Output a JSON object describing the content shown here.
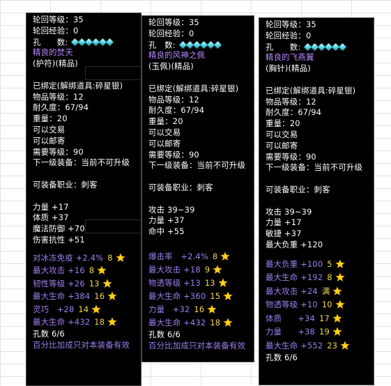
{
  "panels": [
    {
      "reincarnation_level": "轮回等级：35",
      "reincarnation_exp": "轮回经验：0",
      "holes_label": "孔　　数:",
      "name": "精良的焚天",
      "type": "(护符)(精品)",
      "bound": "已绑定(解绑道具:碎星银)",
      "item_level": "物品等级：12",
      "durability": "耐久度：67/94",
      "weight": "重量：20",
      "tradable": "可以交易",
      "mailable": "可以邮寄",
      "required_level": "需要等级：90",
      "next_equip": "下一级装备：当前不可升级",
      "job": "可装备职业：刺客",
      "base_attrs": [
        "力量 +17",
        "体质 +37",
        "魔法防御 +70",
        "伤害抗性 +51"
      ],
      "extra_attrs": [
        {
          "label": "对冰冻免疫 +2.4%",
          "value": "8"
        },
        {
          "label": "最大攻击 +16",
          "value": "8"
        },
        {
          "label": "韧性等级 +26",
          "value": "13"
        },
        {
          "label": "最大生命 +384",
          "value": "16"
        },
        {
          "label": "灵巧　+28",
          "value": "14"
        },
        {
          "label": "最大生命 +432",
          "value": "18"
        }
      ],
      "hole_count": "孔数 6/6",
      "footer": "百分比加成只对本装备有效"
    },
    {
      "reincarnation_level": "轮回等级：35",
      "reincarnation_exp": "轮回经验：0",
      "holes_label": "孔　数:",
      "name": "精良的风神之佩",
      "type": "(玉佩)(精品)",
      "bound": "已绑定(解绑道具:碎星银)",
      "item_level": "物品等级：12",
      "durability": "耐久度：67/94",
      "weight": "重量：20",
      "tradable": "可以交易",
      "mailable": "可以邮寄",
      "required_level": "需要等级：90",
      "next_equip": "下一级装备：当前不可升级",
      "job": "可装备职业：刺客",
      "base_attrs": [
        "攻击 39~39",
        "力量 +37",
        "命中 +55"
      ],
      "extra_attrs": [
        {
          "label": "爆击率　+2.4%",
          "value": "8"
        },
        {
          "label": "最大攻击 +18",
          "value": "9"
        },
        {
          "label": "物透等级 +13",
          "value": "13"
        },
        {
          "label": "最大生命 +360",
          "value": "15"
        },
        {
          "label": "力量　+32",
          "value": "16"
        },
        {
          "label": "最大生命 +432",
          "value": "18"
        }
      ],
      "hole_count": "孔数 6/6",
      "footer": "百分比加成只对本装备有效"
    },
    {
      "reincarnation_level": "轮回等级：35",
      "reincarnation_exp": "轮回经验：0",
      "holes_label": "孔　　数:",
      "name": "精良的飞燕翼",
      "type": "(胸针)(精品)",
      "bound": "已绑定(解绑道具:碎星银)",
      "item_level": "物品等级：12",
      "durability": "耐久度：67/94",
      "weight": "重量：20",
      "tradable": "可以交易",
      "mailable": "可以邮寄",
      "required_level": "需要等级：90",
      "next_equip": "下一级装备：当前不可升级",
      "job": "可装备职业：刺客",
      "base_attrs": [
        "攻击 39~39",
        "力量 +17",
        "敏捷 +37",
        "最大负重 +120"
      ],
      "extra_attrs": [
        {
          "label": "最大负重 +100",
          "value": "5"
        },
        {
          "label": "最大生命 +192",
          "value": "8"
        },
        {
          "label": "最大攻击 +24",
          "value": "满"
        },
        {
          "label": "物透等级 +10",
          "value": "10"
        },
        {
          "label": "体质　　+34",
          "value": "17"
        },
        {
          "label": "力量　　+38",
          "value": "19"
        },
        {
          "label": "最大生命 +552",
          "value": "23"
        }
      ],
      "hole_count": "孔数 6/6"
    }
  ],
  "colors": {
    "panel_bg": "#000000",
    "yellow": "#f2d84c",
    "purple": "#9d7ff0",
    "name": "#b58bff",
    "gem": "#5ee0ee",
    "star": "#ffd21a"
  }
}
